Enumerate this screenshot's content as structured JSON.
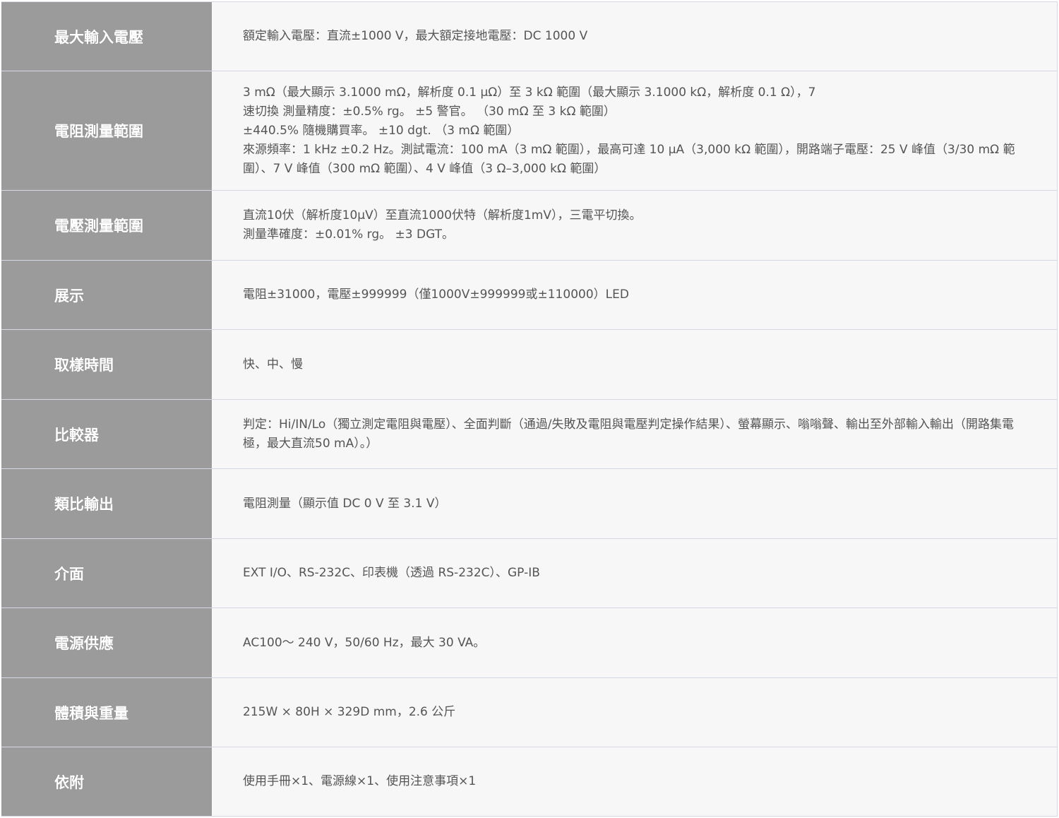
{
  "specs": [
    {
      "label": "最大輸入電壓",
      "lines": [
        "額定輸入電壓：直流±1000 V，最大額定接地電壓：DC 1000 V"
      ]
    },
    {
      "label": "電阻測量範圍",
      "lines": [
        "3 mΩ（最大顯示 3.1000 mΩ，解析度 0.1 μΩ）至 3 kΩ 範圍（最大顯示 3.1000 kΩ，解析度 0.1 Ω），7",
        "速切換 測量精度：±0.5% rg。 ±5 警官。 （30 mΩ 至 3 kΩ 範圍）",
        "±440.5% 隨機購買率。 ±10 dgt. （3 mΩ 範圍）",
        "來源頻率：1 kHz ±0.2 Hz。測試電流：100 mA（3 mΩ 範圍），最高可達 10 μA（3,000 kΩ 範圍），開路端子電壓：25 V 峰值（3/30 mΩ 範圍）、7 V 峰值（300 mΩ 範圍）、4 V 峰值（3 Ω–3,000 kΩ 範圍）"
      ]
    },
    {
      "label": "電壓測量範圍",
      "lines": [
        "直流10伏（解析度10μV）至直流1000伏特（解析度1mV），三電平切換。",
        "測量準確度：±0.01% rg。 ±3 DGT。"
      ]
    },
    {
      "label": "展示",
      "lines": [
        "電阻±31000，電壓±999999（僅1000V±999999或±110000）LED"
      ]
    },
    {
      "label": "取樣時間",
      "lines": [
        "快、中、慢"
      ]
    },
    {
      "label": "比較器",
      "lines": [
        "判定：Hi/IN/Lo（獨立測定電阻與電壓）、全面判斷（通過/失敗及電阻與電壓判定操作結果）、螢幕顯示、嗡嗡聲、輸出至外部輸入輸出（開路集電極，最大直流50 mA）。）"
      ]
    },
    {
      "label": "類比輸出",
      "lines": [
        "電阻測量（顯示值 DC 0 V 至 3.1 V）"
      ]
    },
    {
      "label": "介面",
      "lines": [
        "EXT I/O、RS-232C、印表機（透過 RS-232C）、GP-IB"
      ]
    },
    {
      "label": "電源供應",
      "lines": [
        "AC100～ 240 V，50/60 Hz，最大 30 VA。"
      ]
    },
    {
      "label": "體積與重量",
      "lines": [
        "215W × 80H × 329D mm，2.6 公斤"
      ]
    },
    {
      "label": "依附",
      "lines": [
        "使用手冊×1、電源線×1、使用注意事項×1"
      ]
    }
  ]
}
